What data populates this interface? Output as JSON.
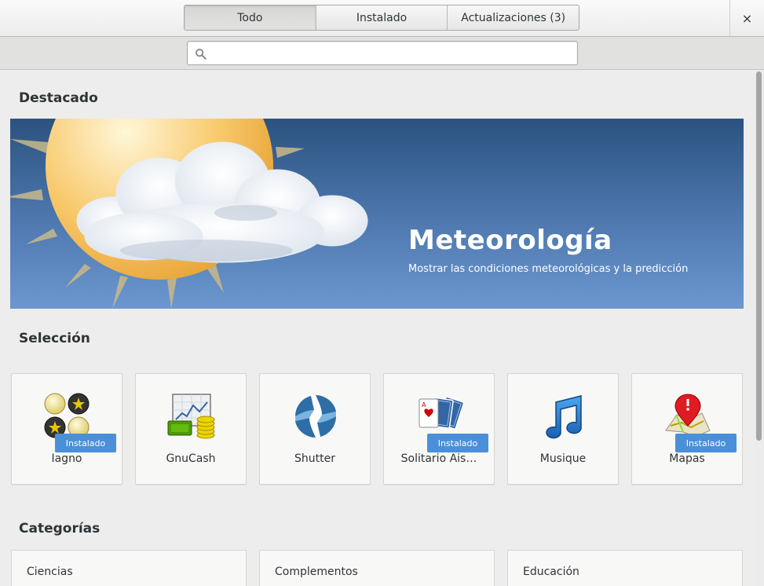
{
  "header": {
    "tabs": [
      {
        "label": "Todo"
      },
      {
        "label": "Instalado"
      },
      {
        "label": "Actualizaciones (3)"
      }
    ],
    "close_label": "×"
  },
  "search": {
    "placeholder": "",
    "value": ""
  },
  "featured": {
    "section_title": "Destacado",
    "app_name": "Meteorología",
    "description": "Mostrar las condiciones meteorológicas y la predicción"
  },
  "selection": {
    "section_title": "Selección",
    "apps": [
      {
        "name": "Iagno",
        "installed": true,
        "badge": "Instalado",
        "icon": "iagno-icon"
      },
      {
        "name": "GnuCash",
        "installed": false,
        "badge": "",
        "icon": "gnucash-icon"
      },
      {
        "name": "Shutter",
        "installed": false,
        "badge": "",
        "icon": "shutter-icon"
      },
      {
        "name": "Solitario Ais…",
        "installed": true,
        "badge": "Instalado",
        "icon": "solitaire-icon"
      },
      {
        "name": "Musique",
        "installed": false,
        "badge": "",
        "icon": "musique-icon"
      },
      {
        "name": "Mapas",
        "installed": true,
        "badge": "Instalado",
        "icon": "maps-icon"
      }
    ]
  },
  "categories": {
    "section_title": "Categorías",
    "items": [
      {
        "label": "Ciencias"
      },
      {
        "label": "Complementos"
      },
      {
        "label": "Educación"
      }
    ]
  },
  "colors": {
    "accent": "#4a90d9",
    "banner_top": "#2b527f",
    "banner_bottom": "#6c97cf"
  }
}
